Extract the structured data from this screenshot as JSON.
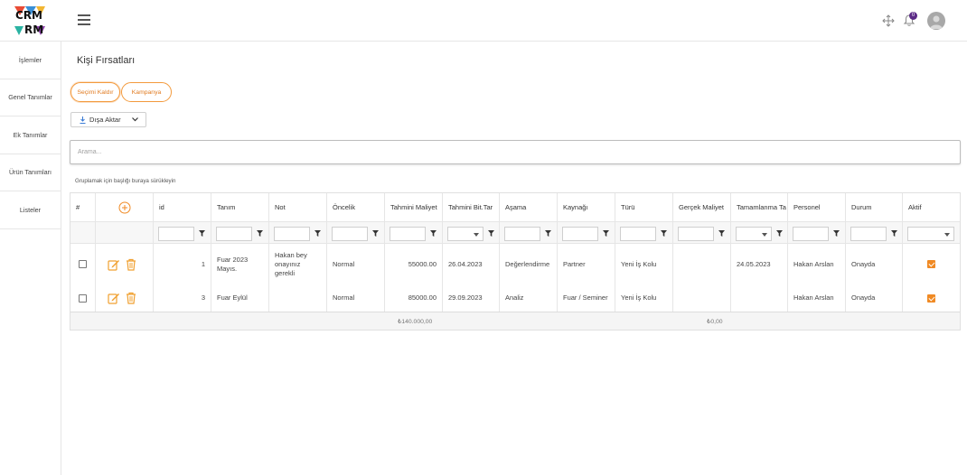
{
  "app": {
    "logo_text": "CRM"
  },
  "header": {
    "notification_count": "0"
  },
  "sidebar": {
    "items": [
      {
        "label": "İşlemler"
      },
      {
        "label": "Genel Tanımlar"
      },
      {
        "label": "Ek Tanımlar"
      },
      {
        "label": "Ürün Tanımları"
      },
      {
        "label": "Listeler"
      }
    ]
  },
  "page": {
    "title": "Kişi Fırsatları",
    "chips": {
      "clear_selection": "Seçimi Kaldır",
      "campaign": "Kampanya"
    },
    "export_label": "Dışa Aktar",
    "search_placeholder": "Arama...",
    "group_hint": "Gruplamak için başlığı buraya sürükleyin"
  },
  "grid": {
    "headers": {
      "hash": "#",
      "id": "id",
      "tanim": "Tanım",
      "not": "Not",
      "oncelik": "Öncelik",
      "tahmini_maliyet": "Tahmini Maliyet",
      "tahmini_bit_tar": "Tahmini Bit.Tar",
      "asama": "Aşama",
      "kaynagi": "Kaynağı",
      "turu": "Türü",
      "gercek_maliyet": "Gerçek Maliyet",
      "tamamlanma": "Tamamlanma Ta",
      "personel": "Personel",
      "durum": "Durum",
      "aktif": "Aktif"
    },
    "rows": [
      {
        "id": "1",
        "tanim": "Fuar 2023 Mayıs.",
        "not": "Hakan bey onayınız gerekli",
        "oncelik": "Normal",
        "tahmini_maliyet": "55000.00",
        "tahmini_bit_tar": "26.04.2023",
        "asama": "Değerlendirme",
        "kaynagi": "Partner",
        "turu": "Yeni İş Kolu",
        "gercek_maliyet": "",
        "tamamlanma": "24.05.2023",
        "personel": "Hakan Arslan",
        "durum": "Onayda",
        "aktif": true
      },
      {
        "id": "3",
        "tanim": "Fuar Eylül",
        "not": "",
        "oncelik": "Normal",
        "tahmini_maliyet": "85000.00",
        "tahmini_bit_tar": "29.09.2023",
        "asama": "Analiz",
        "kaynagi": "Fuar / Seminer",
        "turu": "Yeni İş Kolu",
        "gercek_maliyet": "",
        "tamamlanma": "",
        "personel": "Hakan Arslan",
        "durum": "Onayda",
        "aktif": true
      }
    ],
    "totals": {
      "tahmini_maliyet": "₺140.000,00",
      "gercek_maliyet": "₺0,00"
    }
  },
  "colors": {
    "accent": "#f08a24",
    "badge": "#5b2a86"
  }
}
